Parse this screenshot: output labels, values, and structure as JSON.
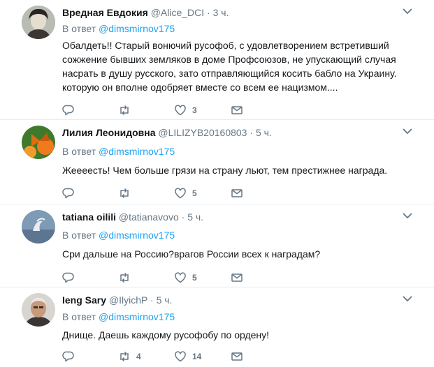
{
  "tweets": [
    {
      "name": "Вредная Евдокия",
      "handle": "@Alice_DCI",
      "time": "3 ч.",
      "reply_prefix": "В ответ",
      "reply_to": "@dimsmirnov175",
      "text": "Обалдеть!! Старый вонючий русофоб, с удовлетворением встретивший сожжение бывших земляков в доме Профсоюзов, не упускающий случая насрать в душу русского, зато отправляющийся косить бабло на Украину. которую он вполне одобряет вместе со всем ее нацизмом....",
      "retweets": "",
      "likes": "3"
    },
    {
      "name": "Лилия Леонидовна",
      "handle": "@LILIZYB20160803",
      "time": "5 ч.",
      "reply_prefix": "В ответ",
      "reply_to": "@dimsmirnov175",
      "text": "Жеееесть! Чем больше грязи на страну льют, тем престижнее награда.",
      "retweets": "",
      "likes": "5"
    },
    {
      "name": "tatiana oilili",
      "handle": "@tatianavovo",
      "time": "5 ч.",
      "reply_prefix": "В ответ",
      "reply_to": "@dimsmirnov175",
      "text": "Сри дальше на Россию?врагов России всех к наградам?",
      "retweets": "",
      "likes": "5"
    },
    {
      "name": "Ieng Sary",
      "handle": "@IlyichP",
      "time": "5 ч.",
      "reply_prefix": "В ответ",
      "reply_to": "@dimsmirnov175",
      "text": "Днище. Даешь каждому русофобу по ордену!",
      "retweets": "4",
      "likes": "14"
    }
  ],
  "colors": {
    "accent": "#1da1f2",
    "muted": "#657786",
    "divider": "#e6ecf0"
  }
}
